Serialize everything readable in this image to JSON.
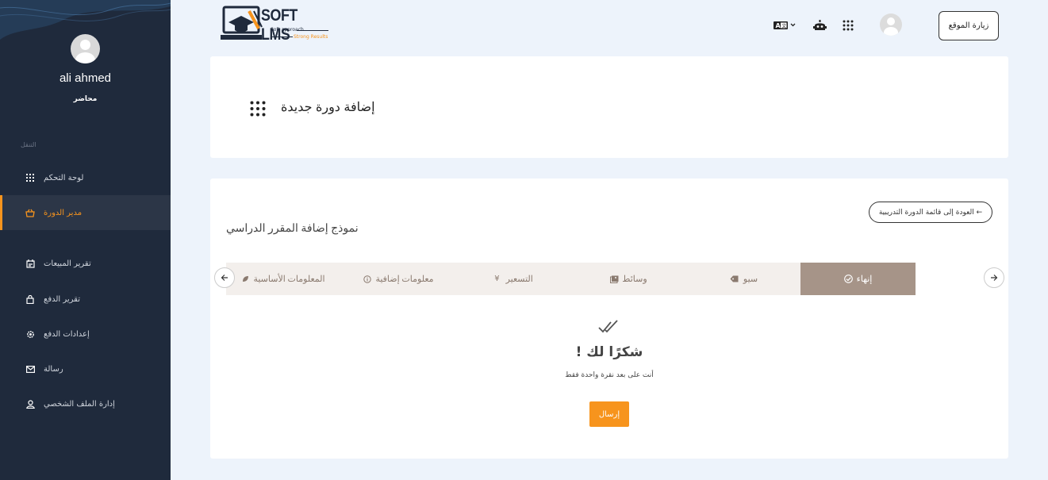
{
  "sidebar": {
    "user_name": "ali ahmed",
    "user_role": "محاضر",
    "nav_heading": "التنقل",
    "items": [
      {
        "label": "لوحة التحكم",
        "icon": "grid-icon"
      },
      {
        "label": "مدير الدورة",
        "icon": "basket-icon",
        "active": true
      },
      {
        "label": "تقرير المبيعات",
        "icon": "calendar-icon"
      },
      {
        "label": "تقرير الدفع",
        "icon": "bag-icon"
      },
      {
        "label": "إعدادات الدفع",
        "icon": "gear-icon"
      },
      {
        "label": "رسالة",
        "icon": "mail-icon"
      },
      {
        "label": "إدارة الملف الشخصي",
        "icon": "user-icon"
      }
    ]
  },
  "header": {
    "logo_text": "SOFT LMS",
    "logo_tagline_1": "Soft approach",
    "logo_tagline_2": "Strong Results",
    "visit_site": "زيارة الموقع",
    "language_icon": "translate-icon",
    "robot_icon": "robot-icon",
    "apps_icon": "apps-grid-icon"
  },
  "page": {
    "title": "إضافة دورة جديدة"
  },
  "form": {
    "back_button": "العودة إلى قائمة الدورة التدريبية ←",
    "title": "نموذج إضافة المقرر الدراسي",
    "steps": [
      {
        "label": "المعلومات الأساسية",
        "icon": "leaf-icon"
      },
      {
        "label": "معلومات إضافية",
        "icon": "info-icon"
      },
      {
        "label": "التسعير",
        "icon": "yen-icon"
      },
      {
        "label": "وسائط",
        "icon": "media-icon"
      },
      {
        "label": "سيو",
        "icon": "tag-icon"
      },
      {
        "label": "إنهاء",
        "icon": "check-circle-icon",
        "active": true
      }
    ],
    "thanks": "! شكرًا لك",
    "sub_text": "أنت على بعد نقرة واحدة فقط",
    "submit": "إرسال"
  },
  "colors": {
    "sidebar_bg": "#1f2a3c",
    "accent": "#f7941d",
    "step_active": "#a69488",
    "page_bg": "#edf3fb"
  }
}
